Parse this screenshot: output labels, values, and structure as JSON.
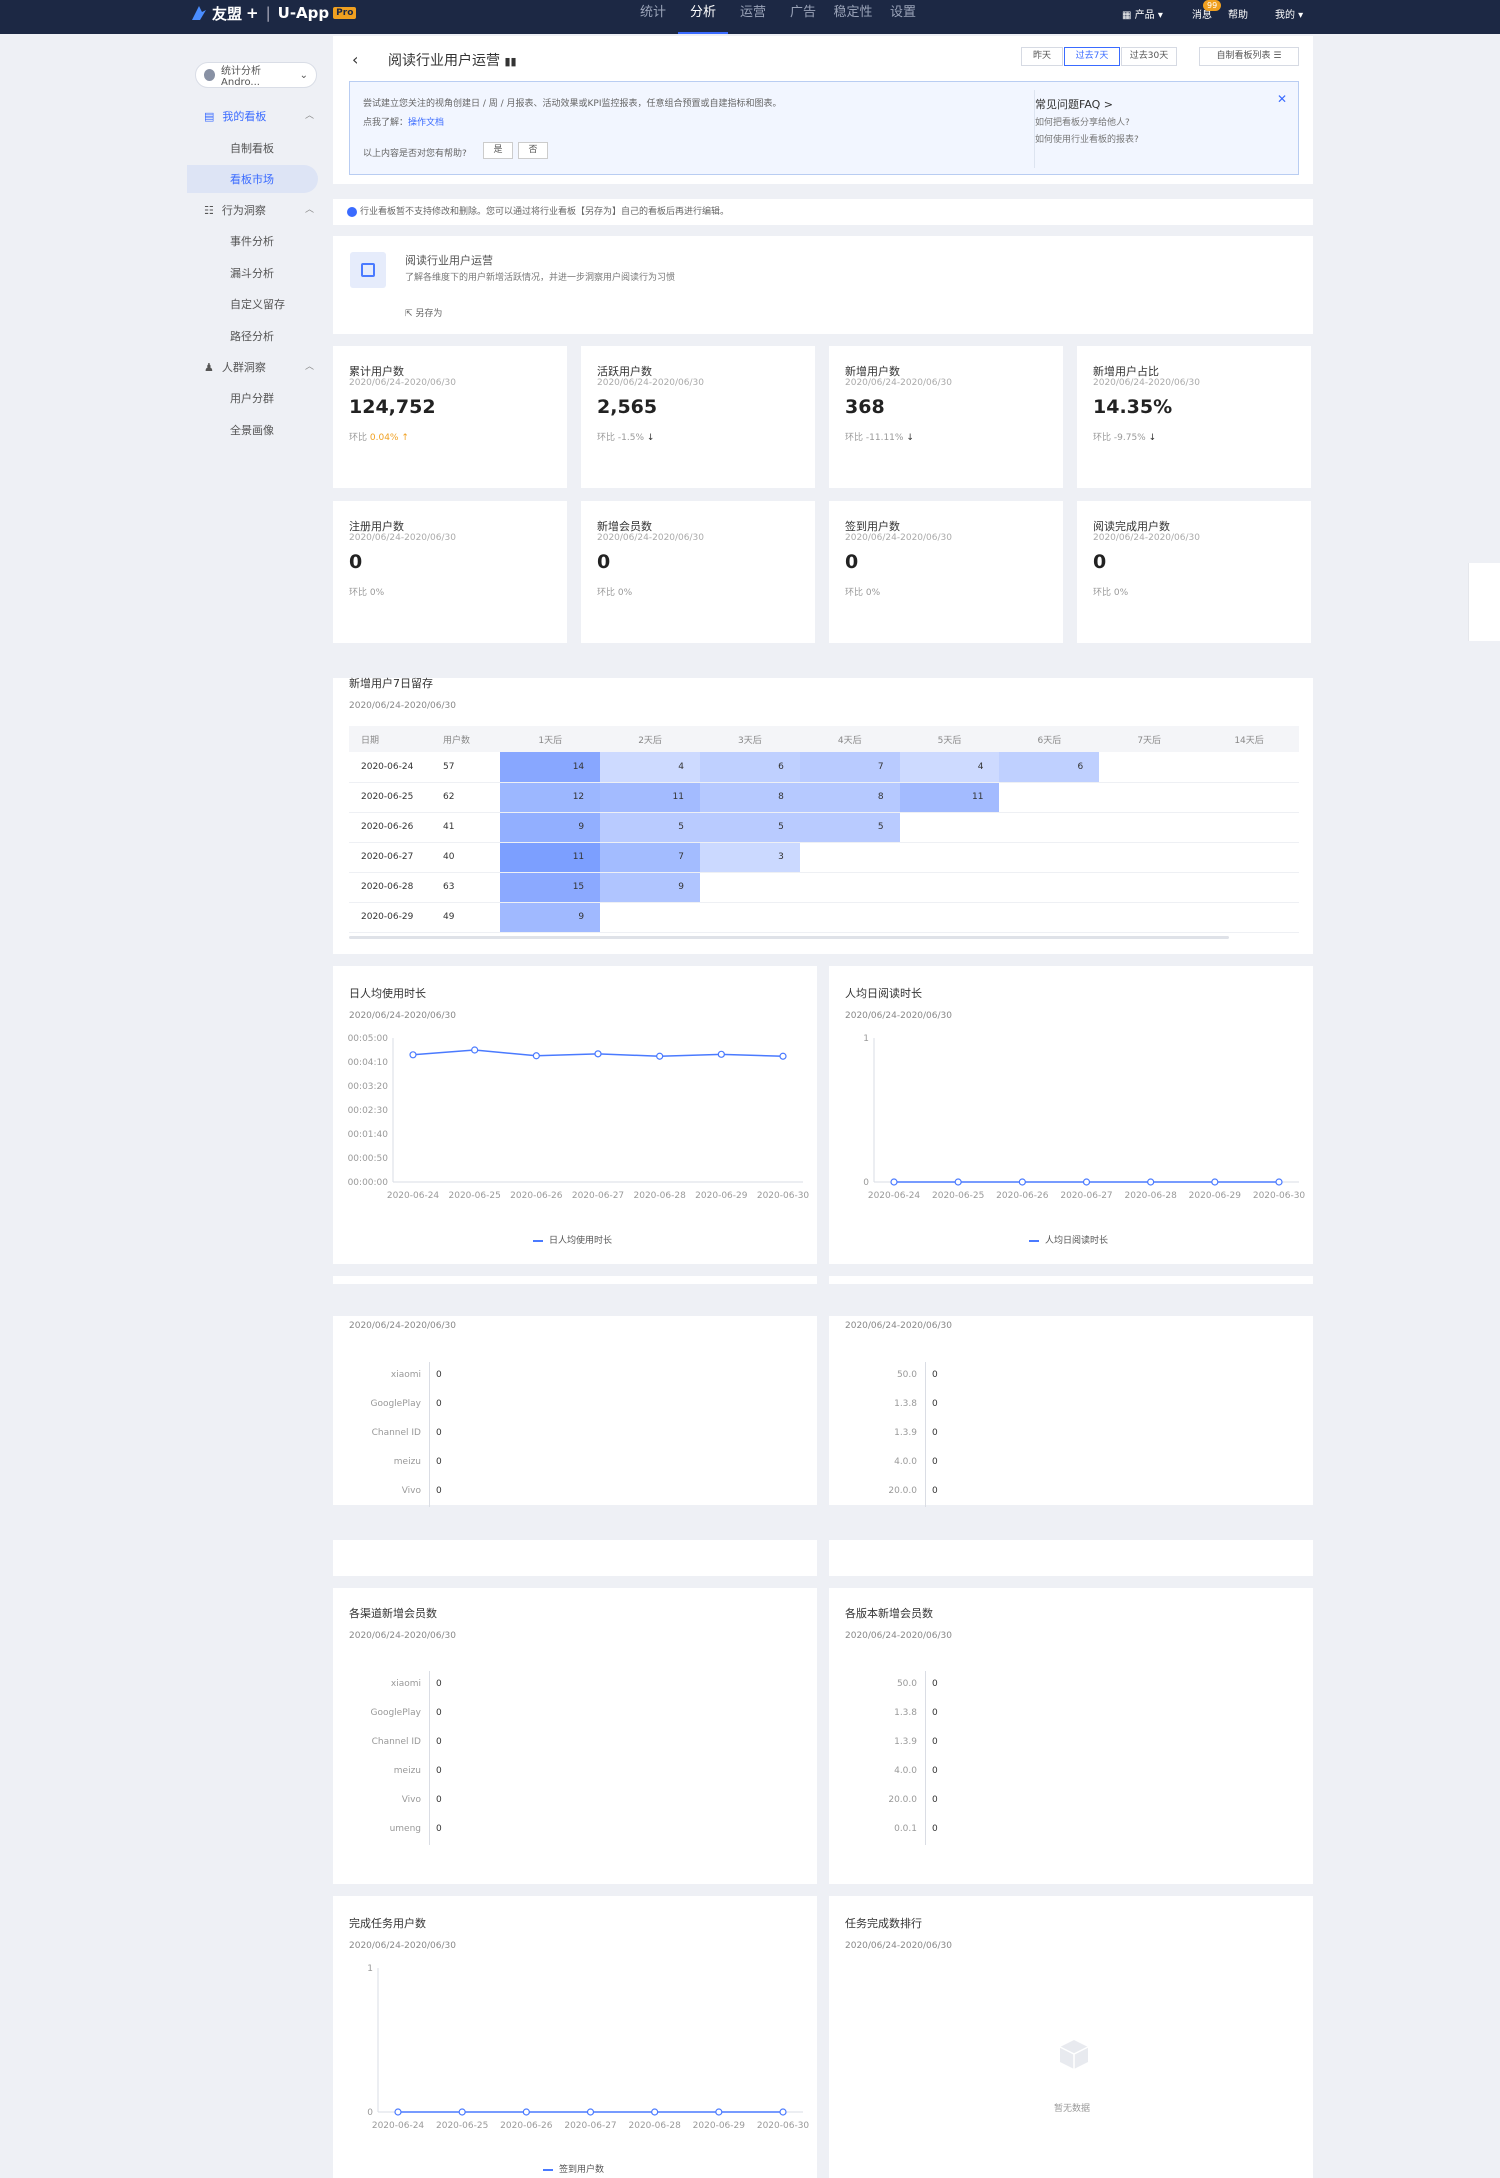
{
  "topbar": {
    "brand": "友盟",
    "plus": "+",
    "product": "U-App",
    "badge": "Pro",
    "nav": [
      "统计",
      "分析",
      "运营",
      "广告",
      "稳定性",
      "设置"
    ],
    "active_nav": "分析",
    "right": {
      "products": "产品",
      "messages": "消息",
      "message_count": "99",
      "help": "帮助",
      "mine": "我的"
    }
  },
  "sidebar": {
    "app_selector": "统计分析Andro...",
    "groups": [
      {
        "label": "我的看板",
        "items": [
          "自制看板",
          "看板市场"
        ]
      },
      {
        "label": "行为洞察",
        "items": [
          "事件分析",
          "漏斗分析",
          "自定义留存",
          "路径分析"
        ]
      },
      {
        "label": "人群洞察",
        "items": [
          "用户分群",
          "全景画像"
        ]
      }
    ],
    "active_item": "看板市场"
  },
  "header": {
    "title": "阅读行业用户运营",
    "date_options": [
      "昨天",
      "过去7天",
      "过去30天"
    ],
    "selected_date": "过去7天",
    "board_list": "自制看板列表"
  },
  "tip": {
    "line1": "尝试建立您关注的视角创建日 / 周 / 月报表、活动效果或KPI监控报表，任意组合预置或自建指标和图表。",
    "line2_prefix": "点我了解：",
    "line2_link": "操作文档",
    "line3": "以上内容是否对您有帮助?",
    "yes": "是",
    "no": "否",
    "faq_title": "常见问题FAQ >",
    "faq": [
      "如何把看板分享给他人?",
      "如何使用行业看板的报表?"
    ]
  },
  "notice": "行业看板暂不支持修改和删除。您可以通过将行业看板【另存为】自己的看板后再进行编辑。",
  "brief": {
    "title": "阅读行业用户运营",
    "desc": "了解各维度下的用户新增活跃情况，并进一步洞察用户阅读行为习惯",
    "save_as": "另存为"
  },
  "kpis": [
    {
      "title": "累计用户数",
      "date": "2020/06/24-2020/06/30",
      "value": "124,752",
      "change_label": "环比",
      "change": "0.04%",
      "dir": "up"
    },
    {
      "title": "活跃用户数",
      "date": "2020/06/24-2020/06/30",
      "value": "2,565",
      "change_label": "环比",
      "change": "-1.5%",
      "dir": "down"
    },
    {
      "title": "新增用户数",
      "date": "2020/06/24-2020/06/30",
      "value": "368",
      "change_label": "环比",
      "change": "-11.11%",
      "dir": "down"
    },
    {
      "title": "新增用户占比",
      "date": "2020/06/24-2020/06/30",
      "value": "14.35%",
      "change_label": "环比",
      "change": "-9.75%",
      "dir": "down"
    },
    {
      "title": "注册用户数",
      "date": "2020/06/24-2020/06/30",
      "value": "0",
      "change_label": "环比",
      "change": "0%",
      "dir": "none"
    },
    {
      "title": "新增会员数",
      "date": "2020/06/24-2020/06/30",
      "value": "0",
      "change_label": "环比",
      "change": "0%",
      "dir": "none"
    },
    {
      "title": "签到用户数",
      "date": "2020/06/24-2020/06/30",
      "value": "0",
      "change_label": "环比",
      "change": "0%",
      "dir": "none"
    },
    {
      "title": "阅读完成用户数",
      "date": "2020/06/24-2020/06/30",
      "value": "0",
      "change_label": "环比",
      "change": "0%",
      "dir": "none"
    }
  ],
  "retention": {
    "title": "新增用户7日留存",
    "date": "2020/06/24-2020/06/30",
    "headers": [
      "日期",
      "用户数",
      "1天后",
      "2天后",
      "3天后",
      "4天后",
      "5天后",
      "6天后",
      "7天后",
      "14天后"
    ],
    "rows": [
      {
        "date": "2020-06-24",
        "users": "57",
        "vals": [
          "14",
          "4",
          "6",
          "7",
          "4",
          "6"
        ]
      },
      {
        "date": "2020-06-25",
        "users": "62",
        "vals": [
          "12",
          "11",
          "8",
          "8",
          "11"
        ]
      },
      {
        "date": "2020-06-26",
        "users": "41",
        "vals": [
          "9",
          "5",
          "5",
          "5"
        ]
      },
      {
        "date": "2020-06-27",
        "users": "40",
        "vals": [
          "11",
          "7",
          "3"
        ]
      },
      {
        "date": "2020-06-28",
        "users": "63",
        "vals": [
          "15",
          "9"
        ]
      },
      {
        "date": "2020-06-29",
        "users": "49",
        "vals": [
          "9"
        ]
      }
    ]
  },
  "charts": {
    "daily_duration": {
      "title": "日人均使用时长",
      "date": "2020/06/24-2020/06/30",
      "legend": "日人均使用时长"
    },
    "daily_reading": {
      "title": "人均日阅读时长",
      "date": "2020/06/24-2020/06/30",
      "legend": "人均日阅读时长"
    },
    "ch_reg": {
      "date": "2020/06/24-2020/06/30"
    },
    "ver_reg": {
      "date": "2020/06/24-2020/06/30"
    },
    "ch_member": {
      "title": "各渠道新增会员数",
      "date": "2020/06/24-2020/06/30"
    },
    "ver_member": {
      "title": "各版本新增会员数",
      "date": "2020/06/24-2020/06/30"
    },
    "task_users": {
      "title": "完成任务用户数",
      "date": "2020/06/24-2020/06/30",
      "legend": "签到用户数"
    },
    "task_rank": {
      "title": "任务完成数排行",
      "date": "2020/06/24-2020/06/30",
      "empty": "暂无数据"
    }
  },
  "chart_data": [
    {
      "type": "line",
      "title": "日人均使用时长",
      "x": [
        "2020-06-24",
        "2020-06-25",
        "2020-06-26",
        "2020-06-27",
        "2020-06-28",
        "2020-06-29",
        "2020-06-30"
      ],
      "yticks": [
        "00:00:00",
        "00:00:50",
        "00:01:40",
        "00:02:30",
        "00:03:20",
        "00:04:10",
        "00:05:00"
      ],
      "ylim": [
        0,
        300
      ],
      "series": [
        {
          "name": "日人均使用时长",
          "values": [
            265,
            275,
            263,
            267,
            262,
            266,
            262
          ]
        }
      ]
    },
    {
      "type": "line",
      "title": "人均日阅读时长",
      "x": [
        "2020-06-24",
        "2020-06-25",
        "2020-06-26",
        "2020-06-27",
        "2020-06-28",
        "2020-06-29",
        "2020-06-30"
      ],
      "yticks": [
        "0",
        "1"
      ],
      "ylim": [
        0,
        1
      ],
      "series": [
        {
          "name": "人均日阅读时长",
          "values": [
            0,
            0,
            0,
            0,
            0,
            0,
            0
          ]
        }
      ]
    },
    {
      "type": "bar",
      "categories": [
        "xiaomi",
        "GooglePlay",
        "Channel ID",
        "meizu",
        "Vivo"
      ],
      "values": [
        0,
        0,
        0,
        0,
        0
      ]
    },
    {
      "type": "bar",
      "categories": [
        "50.0",
        "1.3.8",
        "1.3.9",
        "4.0.0",
        "20.0.0"
      ],
      "values": [
        0,
        0,
        0,
        0,
        0
      ]
    },
    {
      "type": "bar",
      "title": "各渠道新增会员数",
      "categories": [
        "xiaomi",
        "GooglePlay",
        "Channel ID",
        "meizu",
        "Vivo",
        "umeng"
      ],
      "values": [
        0,
        0,
        0,
        0,
        0,
        0
      ]
    },
    {
      "type": "bar",
      "title": "各版本新增会员数",
      "categories": [
        "50.0",
        "1.3.8",
        "1.3.9",
        "4.0.0",
        "20.0.0",
        "0.0.1"
      ],
      "values": [
        0,
        0,
        0,
        0,
        0,
        0
      ]
    },
    {
      "type": "line",
      "title": "完成任务用户数",
      "x": [
        "2020-06-24",
        "2020-06-25",
        "2020-06-26",
        "2020-06-27",
        "2020-06-28",
        "2020-06-29",
        "2020-06-30"
      ],
      "yticks": [
        "0",
        "1"
      ],
      "ylim": [
        0,
        1
      ],
      "series": [
        {
          "name": "签到用户数",
          "values": [
            0,
            0,
            0,
            0,
            0,
            0,
            0
          ]
        }
      ]
    }
  ]
}
